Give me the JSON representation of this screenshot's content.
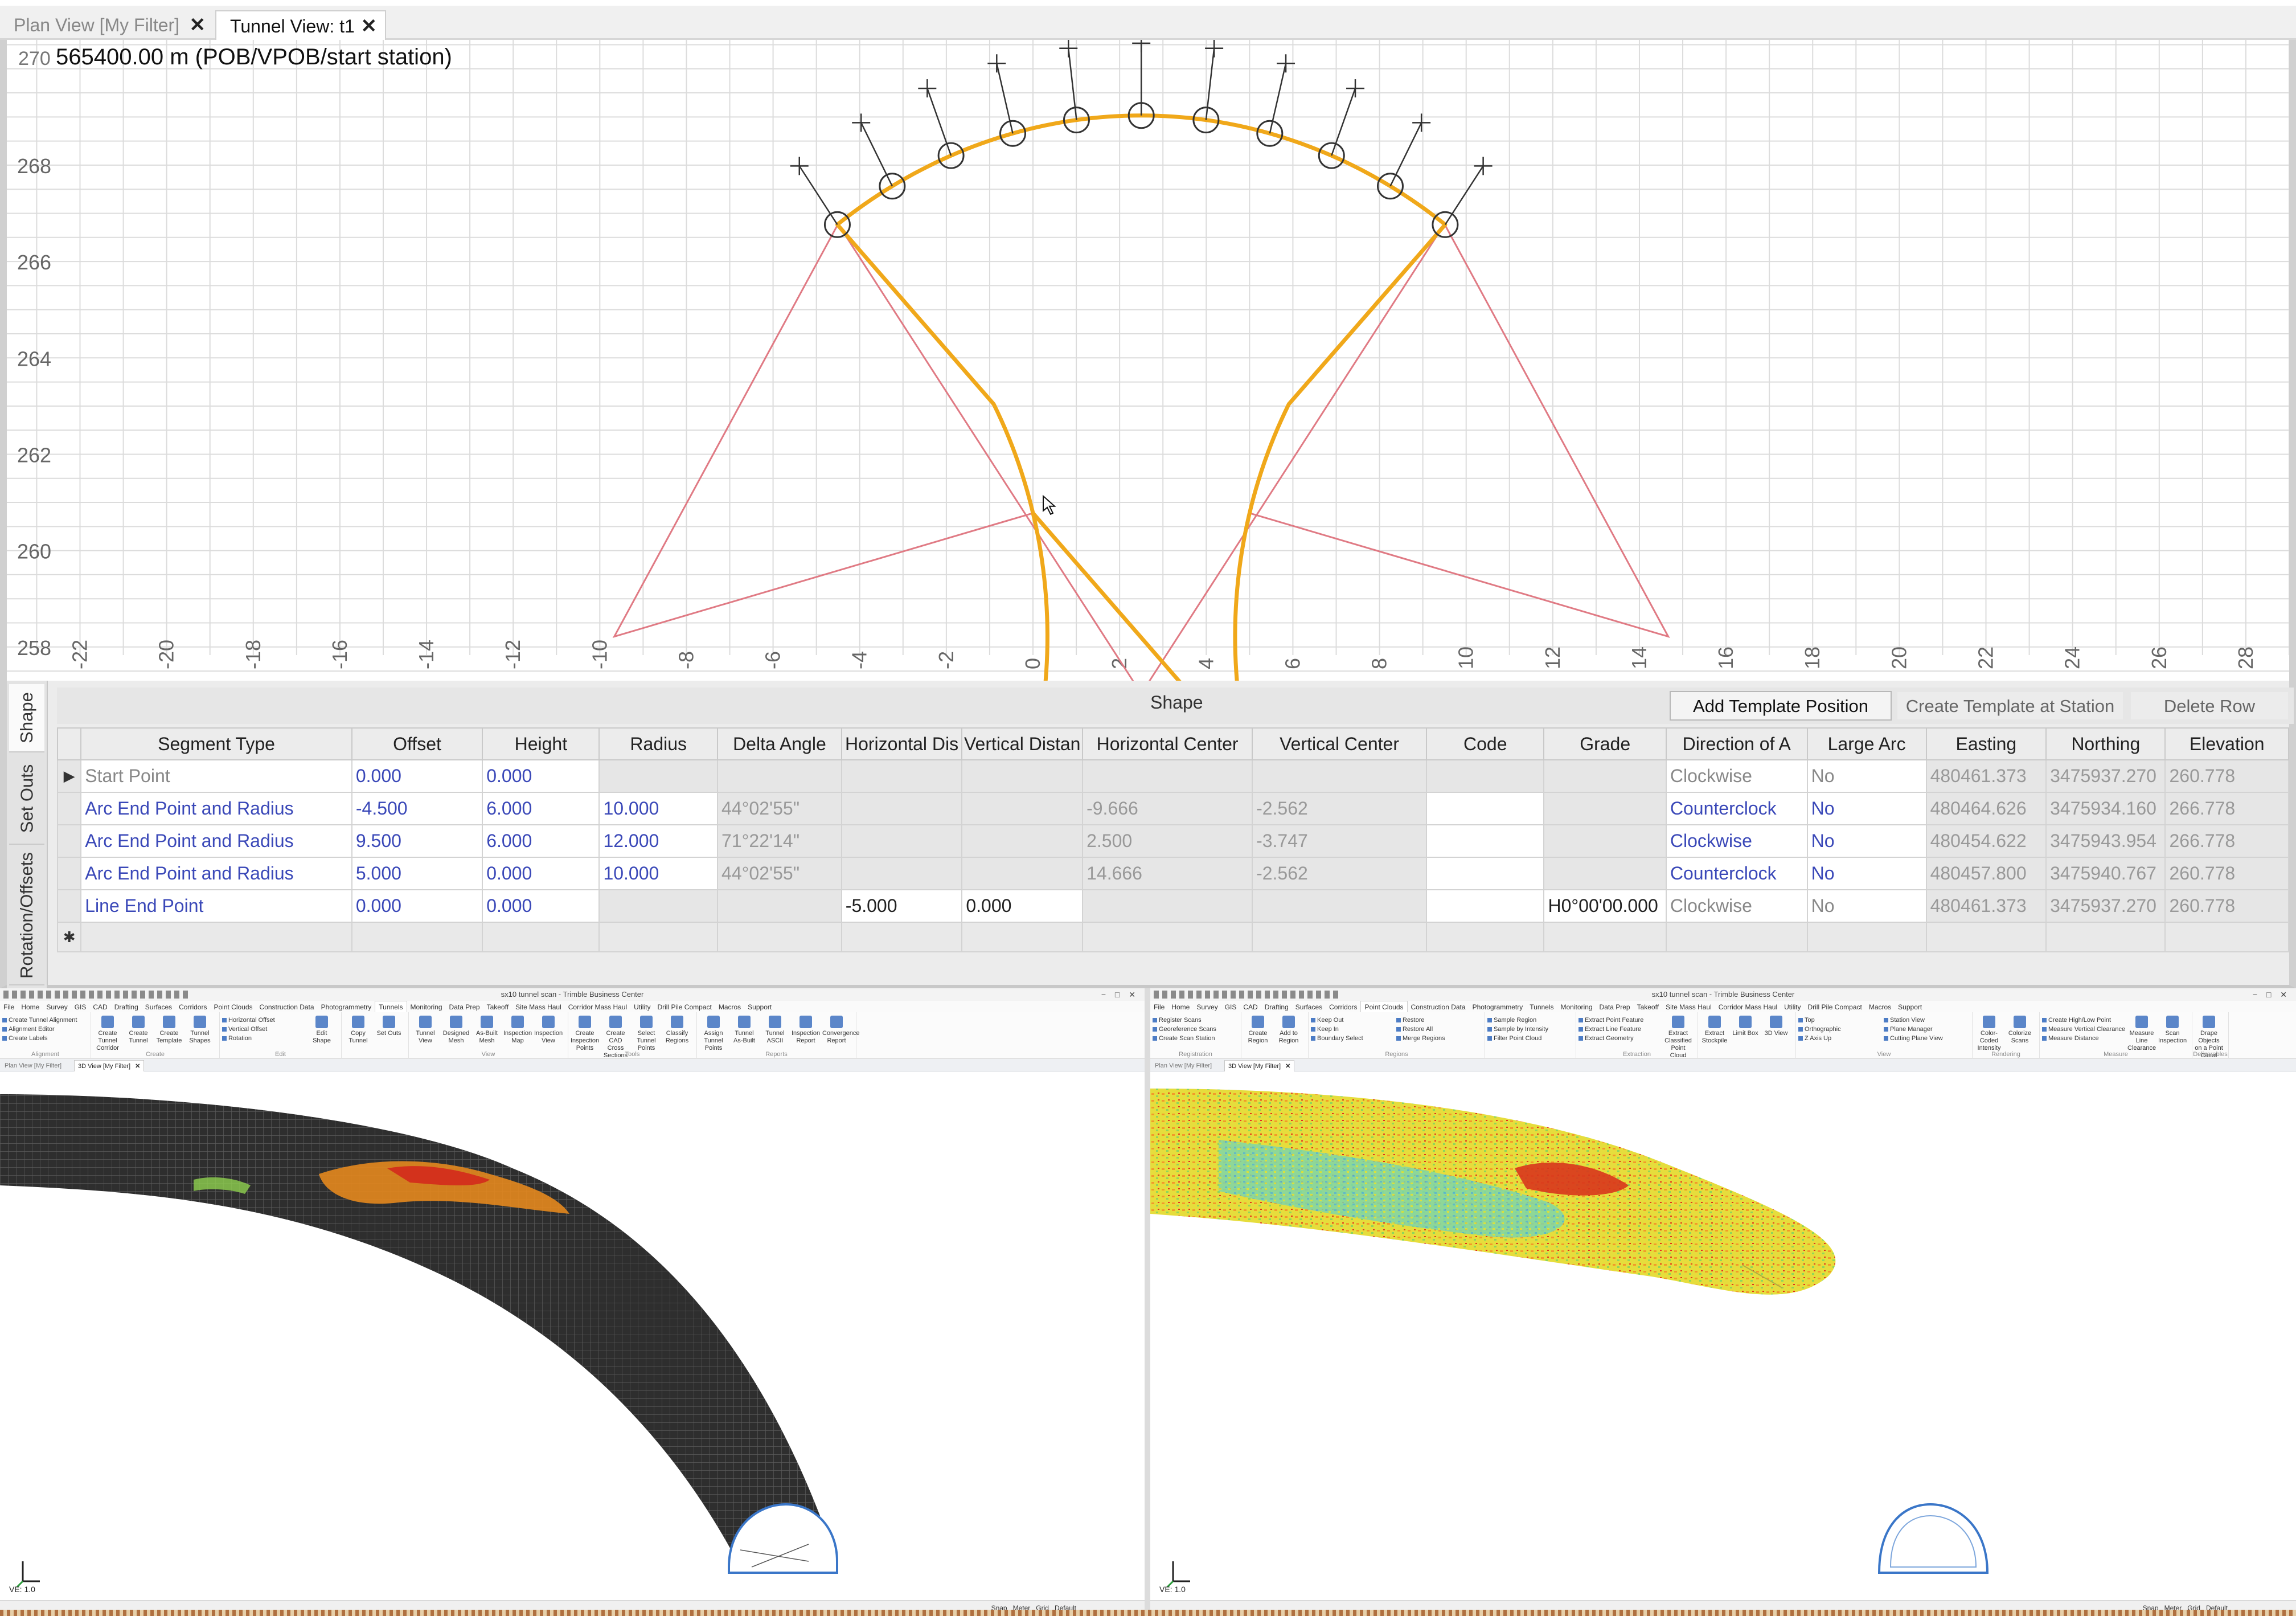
{
  "doc_tabs": [
    {
      "label": "Plan View [My Filter]",
      "close": "✕"
    },
    {
      "label": "Tunnel View: t1",
      "close": "✕"
    }
  ],
  "tunnel_view": {
    "station_label": "565400.00 m (POB/VPOB/start station)",
    "top_y_tick": "270",
    "y_ticks": [
      "268",
      "266",
      "264",
      "262",
      "260",
      "258"
    ],
    "x_ticks": [
      "-22",
      "-20",
      "-18",
      "-16",
      "-14",
      "-12",
      "-10",
      "-8",
      "-6",
      "-4",
      "-2",
      "0",
      "2",
      "4",
      "6",
      "8",
      "10",
      "12",
      "14",
      "16",
      "18",
      "20",
      "22",
      "24",
      "26",
      "28"
    ],
    "x_range": [
      -23.4,
      29
    ],
    "y_range": [
      257.3,
      270.6
    ],
    "colors": {
      "shape": "#f0a81a",
      "construction": "#e07a84",
      "grid": "#dcdcdc"
    }
  },
  "shape_panel": {
    "side_tabs": [
      "Shape",
      "Set Outs",
      "Rotation/Offsets"
    ],
    "title": "Shape",
    "buttons": [
      "Add Template Position",
      "Create Template at Station",
      "Delete Row"
    ],
    "columns": [
      "Segment Type",
      "Offset",
      "Height",
      "Radius",
      "Delta Angle",
      "Horizontal Dis",
      "Vertical Distan",
      "Horizontal Center",
      "Vertical Center",
      "Code",
      "Grade",
      "Direction of A",
      "Large Arc",
      "Easting",
      "Northing",
      "Elevation"
    ],
    "rows": [
      [
        "Start Point",
        "0.000",
        "0.000",
        "",
        "",
        "",
        "",
        "",
        "",
        "",
        "",
        "Clockwise",
        "No",
        "480461.373",
        "3475937.270",
        "260.778"
      ],
      [
        "Arc End Point and Radius",
        "-4.500",
        "6.000",
        "10.000",
        "44°02'55\"",
        "",
        "",
        "-9.666",
        "-2.562",
        "",
        "",
        "Counterclock",
        "No",
        "480464.626",
        "3475934.160",
        "266.778"
      ],
      [
        "Arc End Point and Radius",
        "9.500",
        "6.000",
        "12.000",
        "71°22'14\"",
        "",
        "",
        "2.500",
        "-3.747",
        "",
        "",
        "Clockwise",
        "No",
        "480454.622",
        "3475943.954",
        "266.778"
      ],
      [
        "Arc End Point and Radius",
        "5.000",
        "0.000",
        "10.000",
        "44°02'55\"",
        "",
        "",
        "14.666",
        "-2.562",
        "",
        "",
        "Counterclock",
        "No",
        "480457.800",
        "3475940.767",
        "260.778"
      ],
      [
        "Line End Point",
        "0.000",
        "0.000",
        "",
        "",
        "-5.000",
        "0.000",
        "",
        "",
        "",
        "H0°00'00.000",
        "Clockwise",
        "No",
        "480461.373",
        "3475937.270",
        "260.778"
      ]
    ],
    "current_row_marker": "▶",
    "new_row_marker": "✱"
  },
  "apps": [
    {
      "title": "sx10 tunnel scan - Trimble Business Center",
      "menu": [
        "File",
        "Home",
        "Survey",
        "GIS",
        "CAD",
        "Drafting",
        "Surfaces",
        "Corridors",
        "Point Clouds",
        "Construction Data",
        "Photogrammetry",
        "Tunnels",
        "Monitoring",
        "Data Prep",
        "Takeoff",
        "Site Mass Haul",
        "Corridor Mass Haul",
        "Utility",
        "Drill Pile Compact",
        "Macros",
        "Support"
      ],
      "active_menu": "Tunnels",
      "view_tabs": [
        "Plan View [My Filter]",
        "3D View [My Filter]"
      ],
      "ve": "VE: 1.0",
      "status": [
        "Snap",
        "Meter",
        "Grid",
        "Default"
      ]
    },
    {
      "title": "sx10 tunnel scan - Trimble Business Center",
      "menu": [
        "File",
        "Home",
        "Survey",
        "GIS",
        "CAD",
        "Drafting",
        "Surfaces",
        "Corridors",
        "Point Clouds",
        "Construction Data",
        "Photogrammetry",
        "Tunnels",
        "Monitoring",
        "Data Prep",
        "Takeoff",
        "Site Mass Haul",
        "Corridor Mass Haul",
        "Utility",
        "Drill Pile Compact",
        "Macros",
        "Support"
      ],
      "active_menu": "Point Clouds",
      "view_tabs": [
        "Plan View [My Filter]",
        "3D View [My Filter]"
      ],
      "ve": "VE: 1.0",
      "status": [
        "Snap",
        "Meter",
        "Grid",
        "Default"
      ]
    }
  ],
  "ribbon_tunnels": {
    "groups": [
      {
        "label": "Alignment",
        "list": [
          "Create Tunnel Alignment",
          "Alignment Editor",
          "Create Labels"
        ]
      },
      {
        "label": "Create",
        "buttons": [
          "Create Tunnel Corridor",
          "Create Tunnel",
          "Create Template",
          "Tunnel Shapes"
        ]
      },
      {
        "label": "Edit",
        "buttons": [
          "Edit Shape"
        ],
        "list": [
          "Horizontal Offset",
          "Vertical Offset",
          "Rotation"
        ]
      },
      {
        "label": "",
        "buttons": [
          "Copy Tunnel",
          "Set Outs"
        ]
      },
      {
        "label": "View",
        "buttons": [
          "Tunnel View",
          "Designed Mesh",
          "As-Built Mesh",
          "Inspection Map",
          "Inspection View"
        ]
      },
      {
        "label": "Tools",
        "buttons": [
          "Create Inspection Points",
          "Create CAD Cross Sections",
          "Select Tunnel Points",
          "Classify Regions"
        ]
      },
      {
        "label": "Reports",
        "buttons": [
          "Assign Tunnel Points",
          "Tunnel As-Built",
          "Tunnel ASCII",
          "Inspection Report",
          "Convergence Report"
        ]
      }
    ]
  },
  "ribbon_pointclouds": {
    "groups": [
      {
        "label": "Registration",
        "list": [
          "Register Scans",
          "Georeference Scans",
          "Create Scan Station"
        ]
      },
      {
        "label": "",
        "buttons": [
          "Create Region",
          "Add to Region"
        ]
      },
      {
        "label": "Regions",
        "list": [
          "Keep Out",
          "Keep In",
          "Boundary Select",
          "Restore",
          "Restore All",
          "Merge Regions"
        ]
      },
      {
        "label": "",
        "list": [
          "Sample Region",
          "Sample by Intensity",
          "Filter Point Cloud"
        ]
      },
      {
        "label": "Extraction",
        "buttons": [
          "Extract Classified Point Cloud Regions"
        ],
        "list": [
          "Extract Point Feature",
          "Extract Line Feature",
          "Extract Geometry"
        ]
      },
      {
        "label": "",
        "buttons": [
          "Extract Stockpile",
          "Limit Box",
          "3D View"
        ]
      },
      {
        "label": "View",
        "list": [
          "Top",
          "Orthographic",
          "Z Axis Up",
          "Station View",
          "Plane Manager",
          "Cutting Plane View"
        ]
      },
      {
        "label": "Rendering",
        "buttons": [
          "Color-Coded Intensity",
          "Colorize Scans"
        ]
      },
      {
        "label": "Measure",
        "list": [
          "Create High/Low Point",
          "Measure Vertical Clearance",
          "Measure Distance"
        ],
        "buttons": [
          "Measure Line Clearance",
          "Scan Inspection"
        ]
      },
      {
        "label": "Deliverables",
        "buttons": [
          "Drape Objects on a Point Cloud"
        ]
      }
    ]
  }
}
